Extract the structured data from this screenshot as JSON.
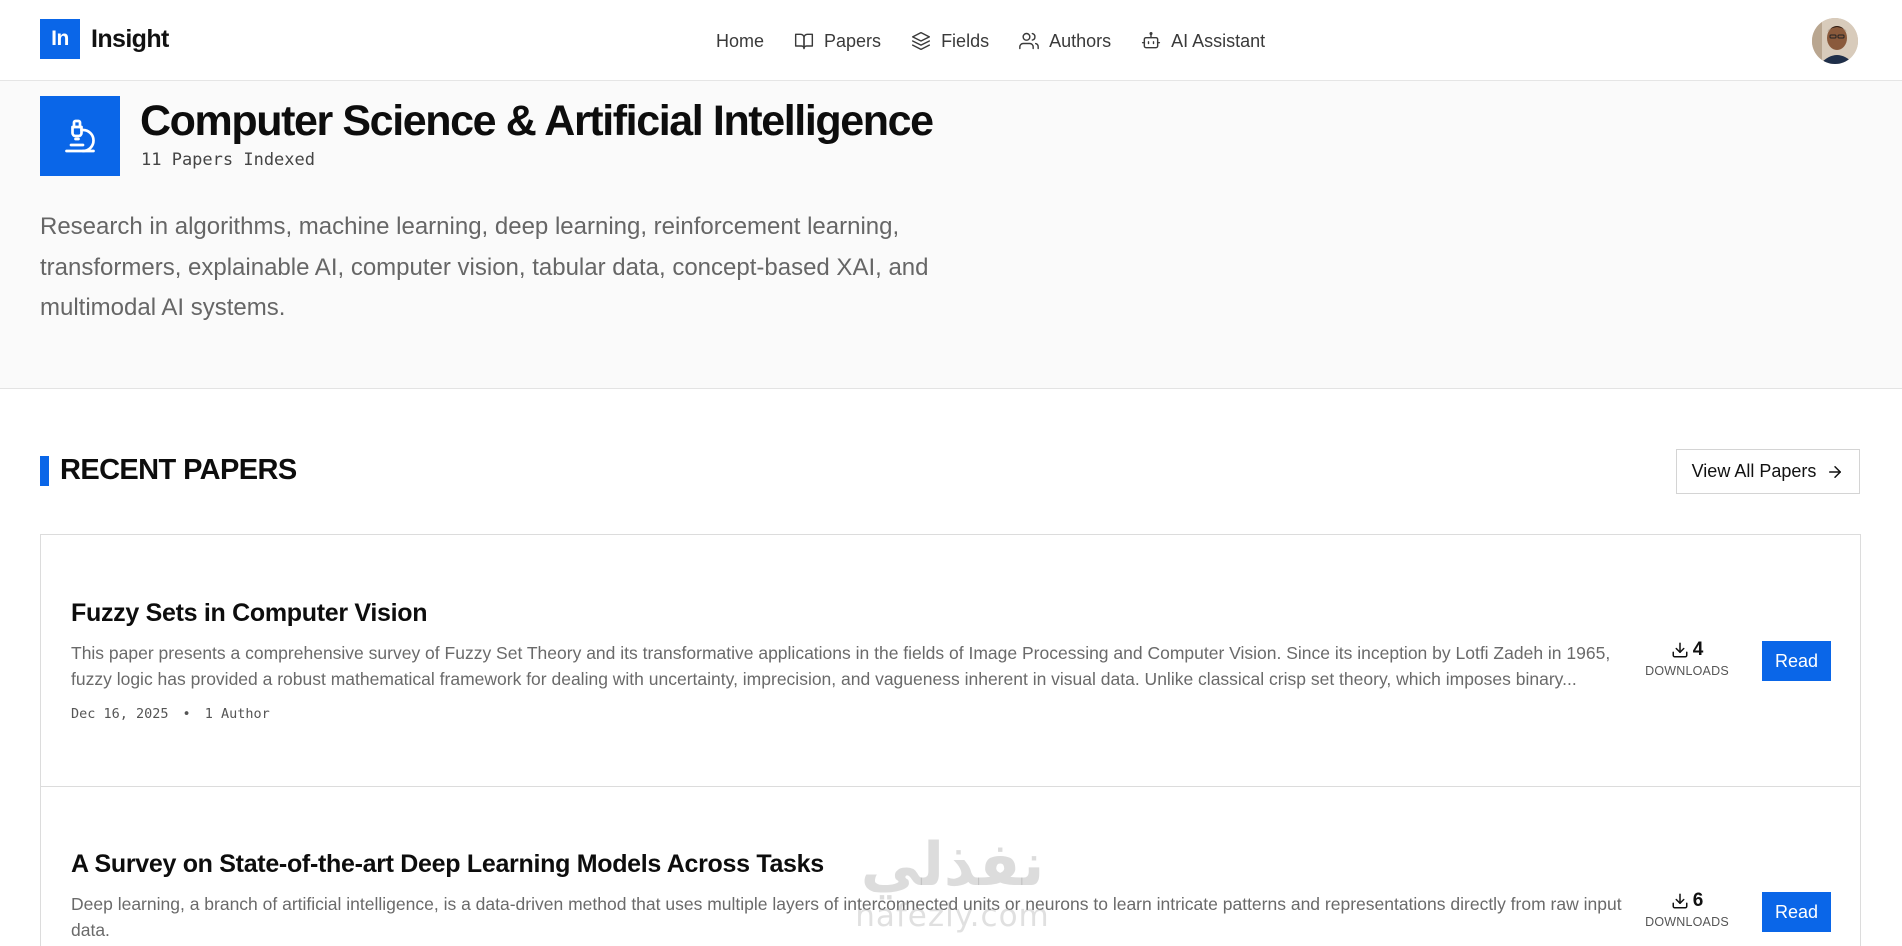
{
  "brand": {
    "mark": "In",
    "name": "Insight"
  },
  "nav": {
    "items": [
      {
        "label": "Home",
        "icon": "none"
      },
      {
        "label": "Papers",
        "icon": "book-open-icon"
      },
      {
        "label": "Fields",
        "icon": "layers-icon"
      },
      {
        "label": "Authors",
        "icon": "users-icon"
      },
      {
        "label": "AI Assistant",
        "icon": "bot-icon"
      }
    ]
  },
  "user": {
    "avatar_icon": "user-avatar"
  },
  "hero": {
    "icon": "microscope-icon",
    "title": "Computer Science & Artificial Intelligence",
    "count": "11 Papers Indexed",
    "description": "Research in algorithms, machine learning, deep learning, reinforcement learning, transformers, explainable AI, computer vision, tabular data, concept-based XAI, and multimodal AI systems."
  },
  "section": {
    "title": "RECENT PAPERS",
    "view_all_label": "View All Papers"
  },
  "papers": [
    {
      "title": "Fuzzy Sets in Computer Vision",
      "abstract": "This paper presents a comprehensive survey of Fuzzy Set Theory and its transformative applications in the fields of Image Processing and Computer Vision. Since its inception by Lotfi Zadeh in 1965, fuzzy logic has provided a robust mathematical framework for dealing with uncertainty, imprecision, and vagueness inherent in visual data. Unlike classical crisp set theory, which imposes binary...",
      "date": "Dec 16, 2025",
      "separator": "•",
      "authors": "1 Author",
      "downloads": "4",
      "downloads_label": "DOWNLOADS",
      "read_label": "Read"
    },
    {
      "title": "A Survey on State-of-the-art Deep Learning Models Across Tasks",
      "abstract": "Deep learning, a branch of artificial intelligence, is a data-driven method that uses multiple layers of interconnected units or neurons to learn intricate patterns and representations directly from raw input data.",
      "downloads": "6",
      "downloads_label": "DOWNLOADS",
      "read_label": "Read"
    }
  ],
  "watermark": {
    "arabic": "نفذلي",
    "latin": "nafezly.com"
  },
  "colors": {
    "accent": "#0a66e8",
    "hero_bg": "#fafafa",
    "border": "#dcdcdc"
  }
}
